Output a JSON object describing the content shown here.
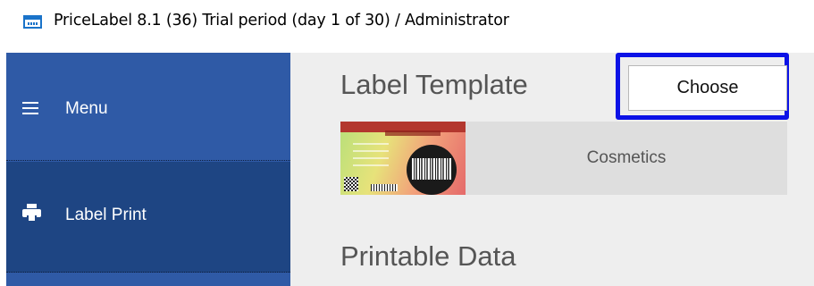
{
  "window": {
    "title": "PriceLabel 8.1 (36) Trial period (day 1 of 30) / Administrator",
    "icon": "app-barcode-icon"
  },
  "sidebar": {
    "items": [
      {
        "label": "Menu",
        "icon": "hamburger-icon"
      },
      {
        "label": "Label Print",
        "icon": "printer-icon",
        "active": true
      }
    ],
    "colors": {
      "background": "#2f5aa6",
      "active": "#1e4583",
      "text": "#ffffff"
    }
  },
  "main": {
    "label_template": {
      "heading": "Label Template",
      "choose_button": "Choose",
      "selected_template": "Cosmetics",
      "highlight_color": "#0c12e6"
    },
    "printable_data": {
      "heading": "Printable Data"
    }
  }
}
